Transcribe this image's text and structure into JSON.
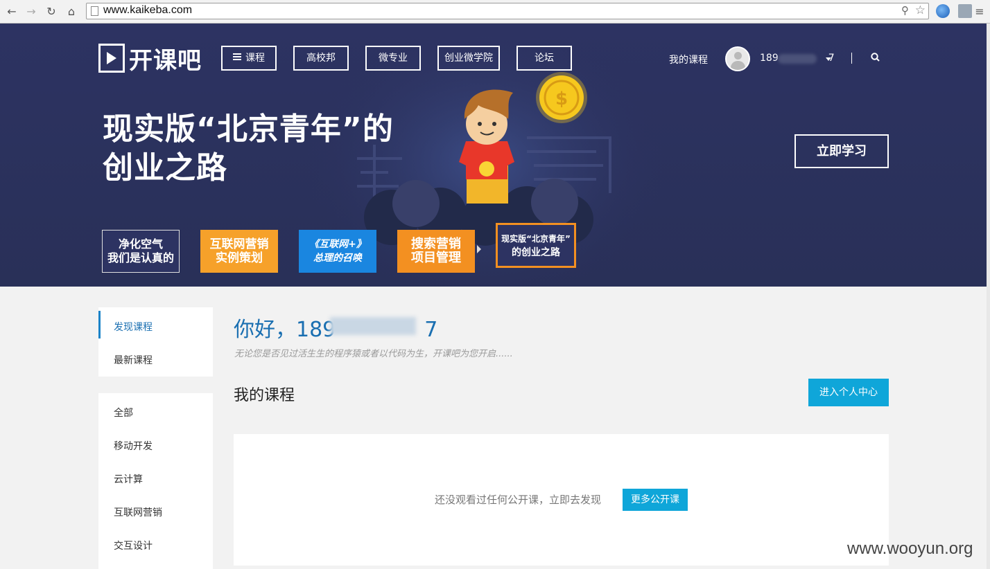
{
  "browser": {
    "url": "www.kaikeba.com"
  },
  "header": {
    "logo_text": "开课吧",
    "nav": [
      "课程",
      "高校邦",
      "微专业",
      "创业微学院",
      "论坛"
    ],
    "my_courses": "我的课程",
    "username": "189",
    "username_tail": "7"
  },
  "hero": {
    "title_line1": "现实版“北京青年”的",
    "title_line2": "创业之路",
    "study_button": "立即学习",
    "thumbnails": [
      {
        "line1": "净化空气",
        "line2": "我们是认真的",
        "color": "#2d3362"
      },
      {
        "line1": "互联网营销",
        "line2": "实例策划",
        "color": "#f6a12a"
      },
      {
        "line1": "《互联网+》",
        "line2": "总理的召唤",
        "color": "#1a86e0"
      },
      {
        "line1": "搜索营销",
        "line2": "项目管理",
        "color": "#f39021"
      },
      {
        "line1": "现实版“北京青年”",
        "line2": "的创业之路",
        "color": "#2d3362"
      }
    ]
  },
  "sidebar": {
    "top_items": [
      "发现课程",
      "最新课程"
    ],
    "categories": [
      "全部",
      "移动开发",
      "云计算",
      "互联网营销",
      "交互设计"
    ]
  },
  "main": {
    "greeting_prefix": "你好，189",
    "greeting_tail": "7",
    "subtitle": "无论您是否见过活生生的程序猿或者以代码为生，开课吧为您开启......",
    "section_title": "我的课程",
    "center_button": "进入个人中心",
    "empty_text": "还没观看过任何公开课，立即去发现",
    "more_button": "更多公开课"
  },
  "watermark": "www.wooyun.org",
  "colors": {
    "hero_bg": "#2d3362",
    "accent": "#0fa6d9",
    "link_blue": "#1a6fb1"
  }
}
